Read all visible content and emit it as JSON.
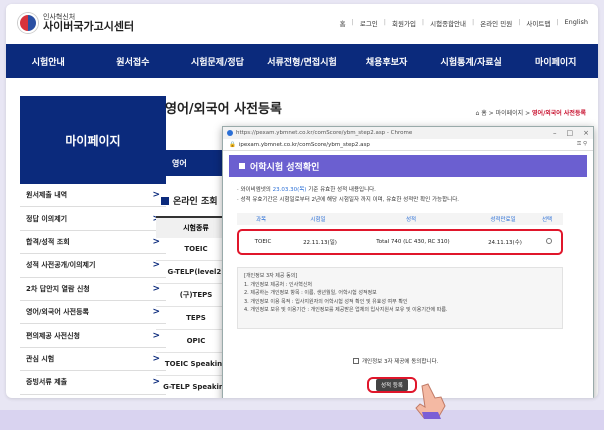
{
  "header": {
    "logo_small": "인사혁신처",
    "logo_big": "사이버국가고시센터",
    "links": [
      "홈",
      "로그인",
      "회원가입",
      "시험종합안내",
      "온라인 민원",
      "사이트맵",
      "English"
    ]
  },
  "nav": [
    "시험안내",
    "원서접수",
    "시험문제/정답",
    "서류전형/면접시험",
    "채용후보자",
    "시험통계/자료실",
    "마이페이지"
  ],
  "sidebar": {
    "title": "마이페이지",
    "items": [
      "원서제출 내역",
      "정답 이의제기",
      "합격/성적 조회",
      "성적 사전공개/이의제기",
      "2차 답안지 열람 신청",
      "영어/외국어 사전등록",
      "편의제공 사전신청",
      "관심 시험",
      "증빙서류 제출"
    ]
  },
  "main": {
    "title": "영어/외국어 사전등록",
    "breadcrumb": [
      "홈",
      "마이페이지",
      "영어/외국어 사전등록"
    ],
    "subtab": "영어",
    "section_title": "온라인 조회",
    "table_header": "시험종류",
    "exam_types": [
      "TOEIC",
      "G-TELP(level2)",
      "(구)TEPS",
      "TEPS",
      "OPIC",
      "TOEIC Speaking",
      "G-TELP Speaking"
    ]
  },
  "popup": {
    "window_title": "https://pexam.ybmnet.co.kr/comScore/ybm_step2.asp - Chrome",
    "url": "ipexam.ybmnet.co.kr/comScore/ybm_step2.asp",
    "heading": "어학시험 성적확인",
    "note1_prefix": "· 와이비엠넷의 ",
    "note1_highlight": "23.03.30(목)",
    "note1_suffix": " 기준 유효한 성적 내용입니다.",
    "note2": "· 성적 유효기간은 시험일로부터 2년에 해당 시험일자 까지 이며, 유효한 성적만 확인 가능합니다.",
    "columns": [
      "과목",
      "시험일",
      "성적",
      "성적만료일",
      "선택"
    ],
    "result": {
      "subject": "TOEIC",
      "date": "22.11.13(일)",
      "score": "Total 740 (LC 430, RC 310)",
      "expiry": "24.11.13(수)"
    },
    "consent_title": "[개인정보 3자 제공 동의]",
    "consent_lines": [
      "1. 개인정보 제공처 : 인사혁신처",
      "2. 제공하는 개인정보 항목 : 이름, 생년월일, 어학시험 성적정보",
      "3. 개인정보 이용 목적 : 입사지원자의 어학시험 성적 확인 및 유효성 여부 확인",
      "4. 개인정보 보유 및 이용기간 : 개인정보를 제공받은 업체의 입사지원서 보유 및 이용기간에 따름."
    ],
    "agree_label": "개인정보 3자 제공에 동의합니다.",
    "submit_label": "성적 등록"
  },
  "colors": {
    "navy": "#0b2a7c",
    "purple": "#6b5fd0",
    "red": "#e0162b"
  }
}
